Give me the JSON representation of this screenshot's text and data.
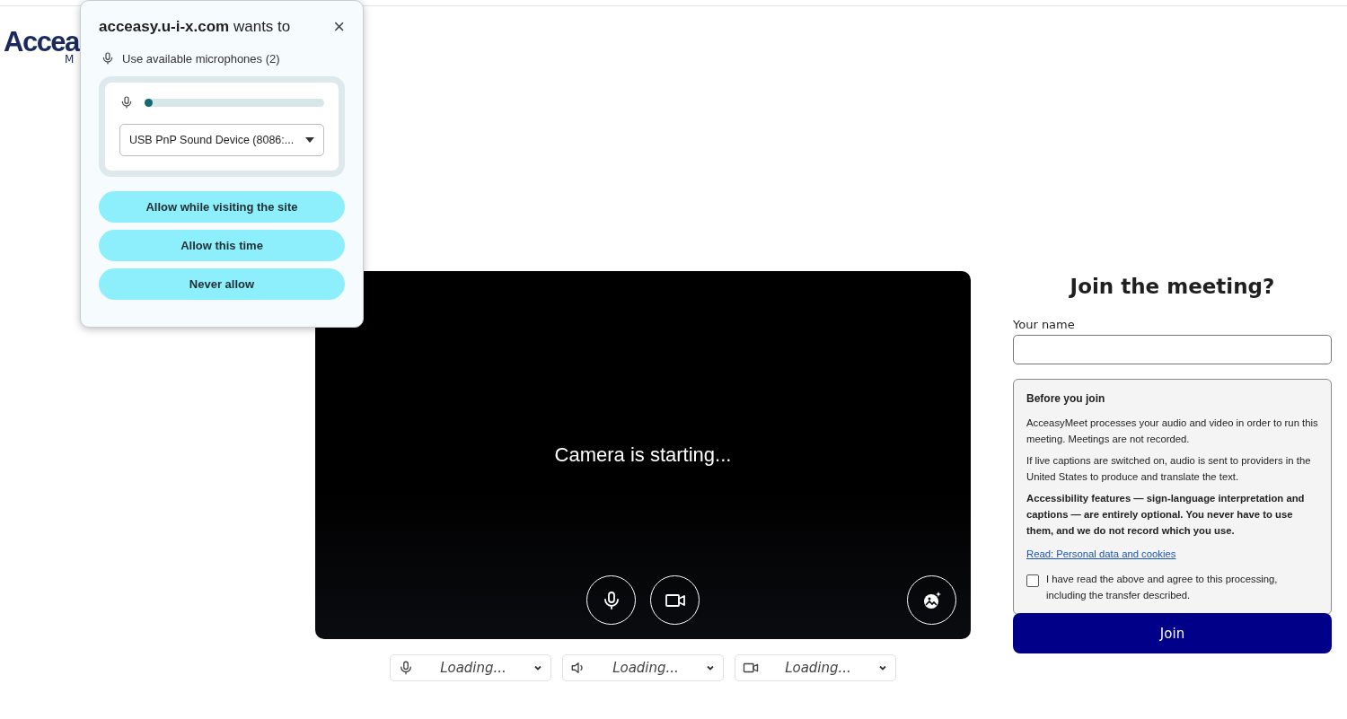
{
  "logo": {
    "word": "Accea",
    "sub": "M"
  },
  "permission_popup": {
    "site": "acceasy.u-i-x.com",
    "title_rest": " wants to",
    "close": "×",
    "request": "Use available microphones (2)",
    "mic_meter": {
      "level": 0.03
    },
    "device_select": {
      "value": "USB PnP Sound Device (8086:..."
    },
    "buttons": [
      "Allow while visiting the site",
      "Allow this time",
      "Never allow"
    ]
  },
  "video": {
    "status": "Camera is starting...",
    "controls": [
      {
        "kind": "mic"
      },
      {
        "kind": "camera"
      },
      {
        "kind": "effects"
      }
    ]
  },
  "device_selectors": [
    {
      "kind": "mic",
      "value": "Loading..."
    },
    {
      "kind": "speaker",
      "value": "Loading..."
    },
    {
      "kind": "camera",
      "value": "Loading..."
    }
  ],
  "join_panel": {
    "title": "Join the meeting?",
    "name_label": "Your name",
    "notice": {
      "heading": "Before you join",
      "paragraphs": [
        {
          "text": "AcceasyMeet processes your audio and video in order to run this meeting. Meetings are not recorded.",
          "bold": false
        },
        {
          "text": "If live captions are switched on, audio is sent to providers in the United States to produce and translate the text.",
          "bold": false
        },
        {
          "text": "Accessibility features — sign-language interpretation and captions — are entirely optional. You never have to use them, and we do not record which you use.",
          "bold": true
        }
      ],
      "link": "Read: Personal data and cookies",
      "consent": {
        "label": "I have read the above and agree to this processing, including the transfer described.",
        "checked": false
      }
    },
    "join_button": "Join"
  }
}
